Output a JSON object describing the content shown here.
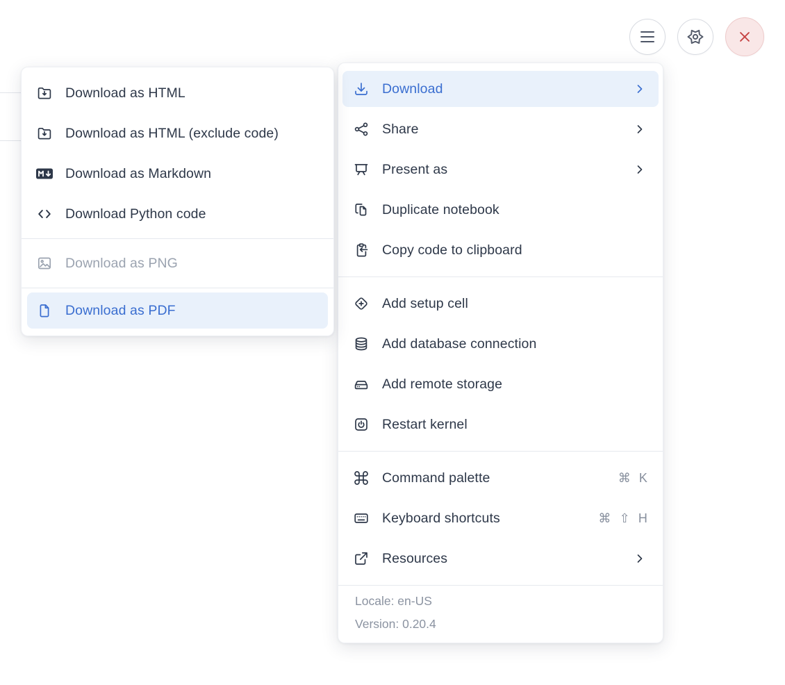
{
  "toolbar": {
    "buttons": [
      {
        "icon": "hamburger-menu-icon"
      },
      {
        "icon": "settings-gear-icon"
      },
      {
        "icon": "close-x-icon"
      }
    ]
  },
  "download_submenu": {
    "items": [
      {
        "label": "Download as HTML",
        "icon": "folder-download-icon",
        "state": "normal"
      },
      {
        "label": "Download as HTML (exclude code)",
        "icon": "folder-download-icon",
        "state": "normal"
      },
      {
        "label": "Download as Markdown",
        "icon": "markdown-badge-icon",
        "state": "normal"
      },
      {
        "label": "Download Python code",
        "icon": "code-brackets-icon",
        "state": "normal"
      },
      {
        "label": "Download as PNG",
        "icon": "image-icon",
        "state": "disabled"
      },
      {
        "label": "Download as PDF",
        "icon": "file-icon",
        "state": "highlighted"
      }
    ]
  },
  "main_menu": {
    "items": [
      {
        "label": "Download",
        "icon": "download-tray-icon",
        "state": "highlighted",
        "has_submenu": true
      },
      {
        "label": "Share",
        "icon": "share-nodes-icon",
        "has_submenu": true
      },
      {
        "label": "Present as",
        "icon": "presentation-board-icon",
        "has_submenu": true
      },
      {
        "label": "Duplicate notebook",
        "icon": "duplicate-pages-icon"
      },
      {
        "label": "Copy code to clipboard",
        "icon": "clipboard-arrow-icon"
      },
      {
        "label": "Add setup cell",
        "icon": "diamond-plus-icon"
      },
      {
        "label": "Add database connection",
        "icon": "database-icon"
      },
      {
        "label": "Add remote storage",
        "icon": "storage-drive-icon"
      },
      {
        "label": "Restart kernel",
        "icon": "power-square-icon"
      },
      {
        "label": "Command palette",
        "icon": "command-key-icon",
        "shortcut": "⌘ K"
      },
      {
        "label": "Keyboard shortcuts",
        "icon": "keyboard-icon",
        "shortcut": "⌘ ⇧ H"
      },
      {
        "label": "Resources",
        "icon": "external-link-icon",
        "has_submenu": true
      }
    ],
    "footer": {
      "locale": "Locale: en-US",
      "version": "Version: 0.20.4"
    }
  },
  "colors": {
    "accent_blue": "#3a6ed0",
    "highlight_background": "#e9f1fb",
    "text": "#2e3849",
    "muted_gray": "#8b93a1",
    "disabled_gray": "#9ba3b0",
    "danger_red": "#c64343",
    "danger_background": "#f9e7e7"
  }
}
